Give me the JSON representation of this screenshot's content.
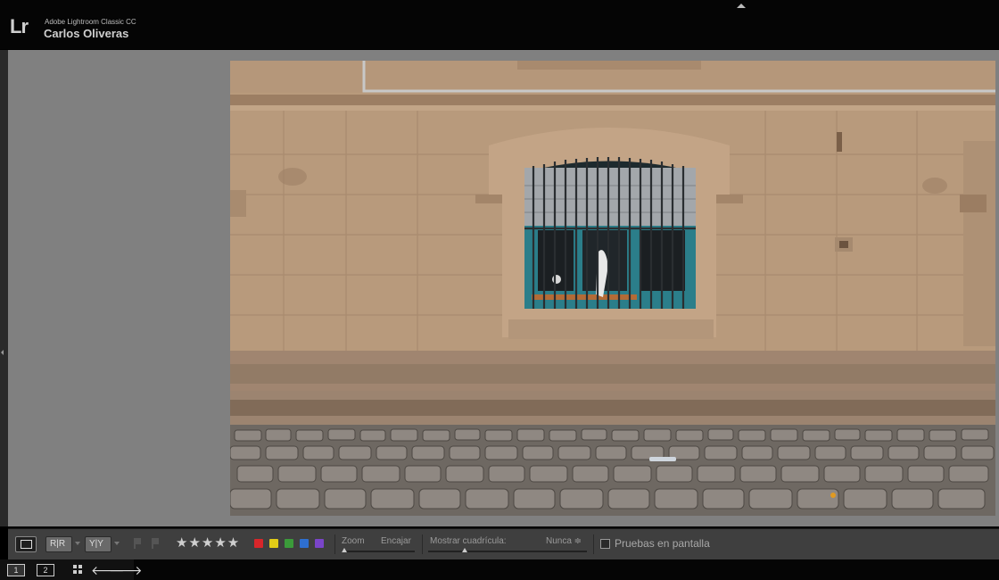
{
  "identity": {
    "logo": "Lr",
    "product_name": "Adobe Lightroom Classic CC",
    "user_name": "Carlos Oliveras"
  },
  "photo": {
    "subject": "stone-wall-barred-window-cobblestones"
  },
  "toolbar": {
    "zoom_label": "Zoom",
    "zoom_value": "Encajar",
    "grid_label": "Mostrar cuadrícula:",
    "grid_value": "Nunca ≑",
    "proof_label": "Pruebas en pantalla",
    "stars": "★★★★★",
    "color_labels": [
      "#d8262a",
      "#e2cc17",
      "#3b9b3a",
      "#2e6fd0",
      "#7a45c9"
    ]
  },
  "filmstrip": {
    "monitor_1": "1",
    "monitor_2": "2",
    "prev_arrow": "🡐",
    "next_arrow": "🡒"
  },
  "colors": {
    "canvas": "#808080",
    "toolbar": "#3f3f3f",
    "identity_plate": "#050505"
  }
}
